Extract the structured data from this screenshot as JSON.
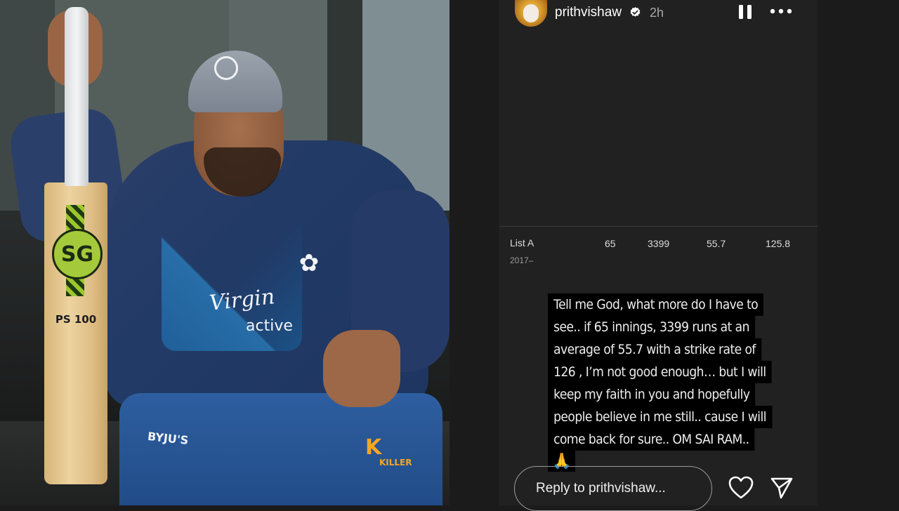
{
  "photo": {
    "bat_signature": "PS 100",
    "bat_logo": "SG",
    "jersey_sponsor": "Virgin",
    "jersey_sponsor_sub": "active",
    "shorts_sponsor_left": "BYJU'S",
    "shorts_sponsor_right": "K",
    "shorts_sponsor_right_sub": "KILLER"
  },
  "story": {
    "username": "prithvishaw",
    "verified": true,
    "time": "2h",
    "stats": {
      "label": "List A",
      "years": "2017–",
      "cells": [
        "65",
        "3399",
        "55.7",
        "125.8"
      ]
    },
    "caption_lines": [
      "Tell me God, what more do I have to",
      "see.. if 65 innings, 3399 runs at an",
      "average of 55.7 with a strike rate of",
      "126 , I’m not good enough… but I will",
      "keep my faith in you and hopefully",
      "people believe in me still.. cause I will",
      "come back for sure.. OM SAI RAM.."
    ],
    "caption_emoji": "🙏",
    "reply_placeholder": "Reply to prithvishaw...",
    "icons": {
      "pause": "pause-icon",
      "more": "more-horizontal-icon",
      "like": "heart-icon",
      "share": "send-icon"
    },
    "colors": {
      "background": "#202020",
      "caption_bg": "#000000",
      "text": "#ffffff"
    }
  }
}
